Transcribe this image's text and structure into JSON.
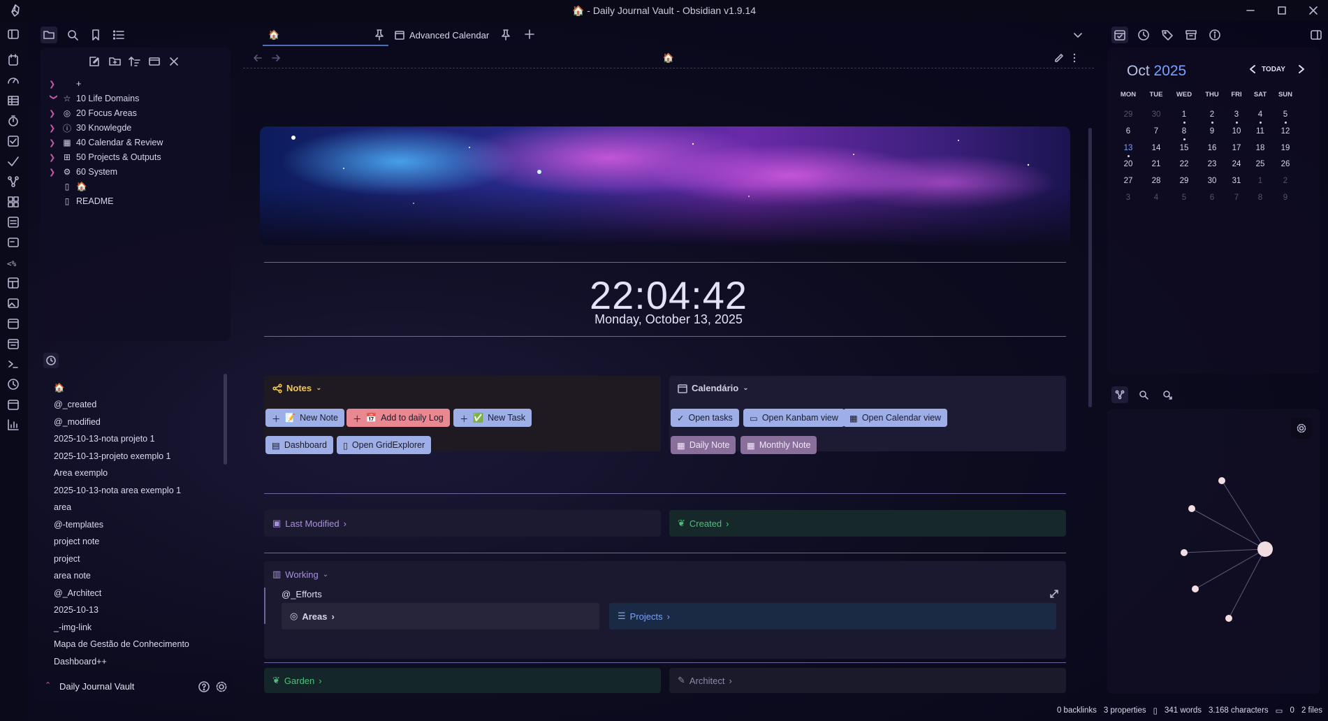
{
  "window": {
    "title": "🏠 - Daily Journal Vault - Obsidian v1.9.14"
  },
  "tabs": [
    {
      "label": "🏠"
    },
    {
      "label": "Advanced Calendar"
    }
  ],
  "file_tree": [
    {
      "label": "+",
      "icon": "none"
    },
    {
      "label": "10 Life Domains",
      "icon": "star-icon"
    },
    {
      "label": "20 Focus Areas",
      "icon": "target-icon"
    },
    {
      "label": "30 Knowlegde",
      "icon": "info-icon"
    },
    {
      "label": "40 Calendar & Review",
      "icon": "calendar-icon"
    },
    {
      "label": "50 Projects & Outputs",
      "icon": "grid-icon"
    },
    {
      "label": "60 System",
      "icon": "gear-icon"
    },
    {
      "label": "🏠",
      "icon": "file-icon"
    },
    {
      "label": "README",
      "icon": "file-icon"
    }
  ],
  "recent_files": [
    "🏠",
    "@_created",
    "@_modified",
    "2025-10-13-nota projeto 1",
    "2025-10-13-projeto exemplo 1",
    "Area exemplo",
    "2025-10-13-nota area exemplo 1",
    "area",
    "@-templates",
    "project note",
    "project",
    "area note",
    "@_Architect",
    "2025-10-13",
    "_-img-link",
    "Mapa de Gestão de Conhecimento",
    "Dashboard++"
  ],
  "vault": {
    "name": "Daily Journal Vault"
  },
  "breadcrumb": {
    "title": "🏠"
  },
  "clock": {
    "time": "22:04:42",
    "date": "Monday, October 13, 2025"
  },
  "notes_card": {
    "title": "Notes",
    "buttons": [
      "New Note",
      "Add to daily Log",
      "New Task",
      "Dashboard",
      "Open GridExplorer"
    ]
  },
  "calendar_card": {
    "title": "Calendário",
    "buttons": [
      "Open tasks",
      "Open Kanbam view",
      "Open Calendar view",
      "Daily Note",
      "Monthly Note"
    ]
  },
  "sections": {
    "last_modified": "Last Modified",
    "created": "Created",
    "working": "Working",
    "efforts": "@_Efforts",
    "areas": "Areas",
    "projects": "Projects",
    "garden": "Garden",
    "architect": "Architect"
  },
  "mini_calendar": {
    "month": "Oct",
    "year": "2025",
    "today_label": "TODAY",
    "weekdays": [
      "MON",
      "TUE",
      "WED",
      "THU",
      "FRI",
      "SAT",
      "SUN"
    ],
    "weeks": [
      [
        "29",
        "30",
        "1",
        "2",
        "3",
        "4",
        "5"
      ],
      [
        "6",
        "7",
        "8",
        "9",
        "10",
        "11",
        "12"
      ],
      [
        "13",
        "14",
        "15",
        "16",
        "17",
        "18",
        "19"
      ],
      [
        "20",
        "21",
        "22",
        "23",
        "24",
        "25",
        "26"
      ],
      [
        "27",
        "28",
        "29",
        "30",
        "31",
        "1",
        "2"
      ],
      [
        "3",
        "4",
        "5",
        "6",
        "7",
        "8",
        "9"
      ]
    ]
  },
  "status": {
    "backlinks": "0 backlinks",
    "properties": "3 properties",
    "words": "341 words",
    "characters": "3.168 characters",
    "comments": "0",
    "files": "2 files"
  },
  "colors": {
    "accent": "#7aa1ff",
    "notes_title": "#f2c94c",
    "created_green": "#4ec07a",
    "garden_green": "#4ec07a",
    "link_purple": "#a98fe0"
  }
}
